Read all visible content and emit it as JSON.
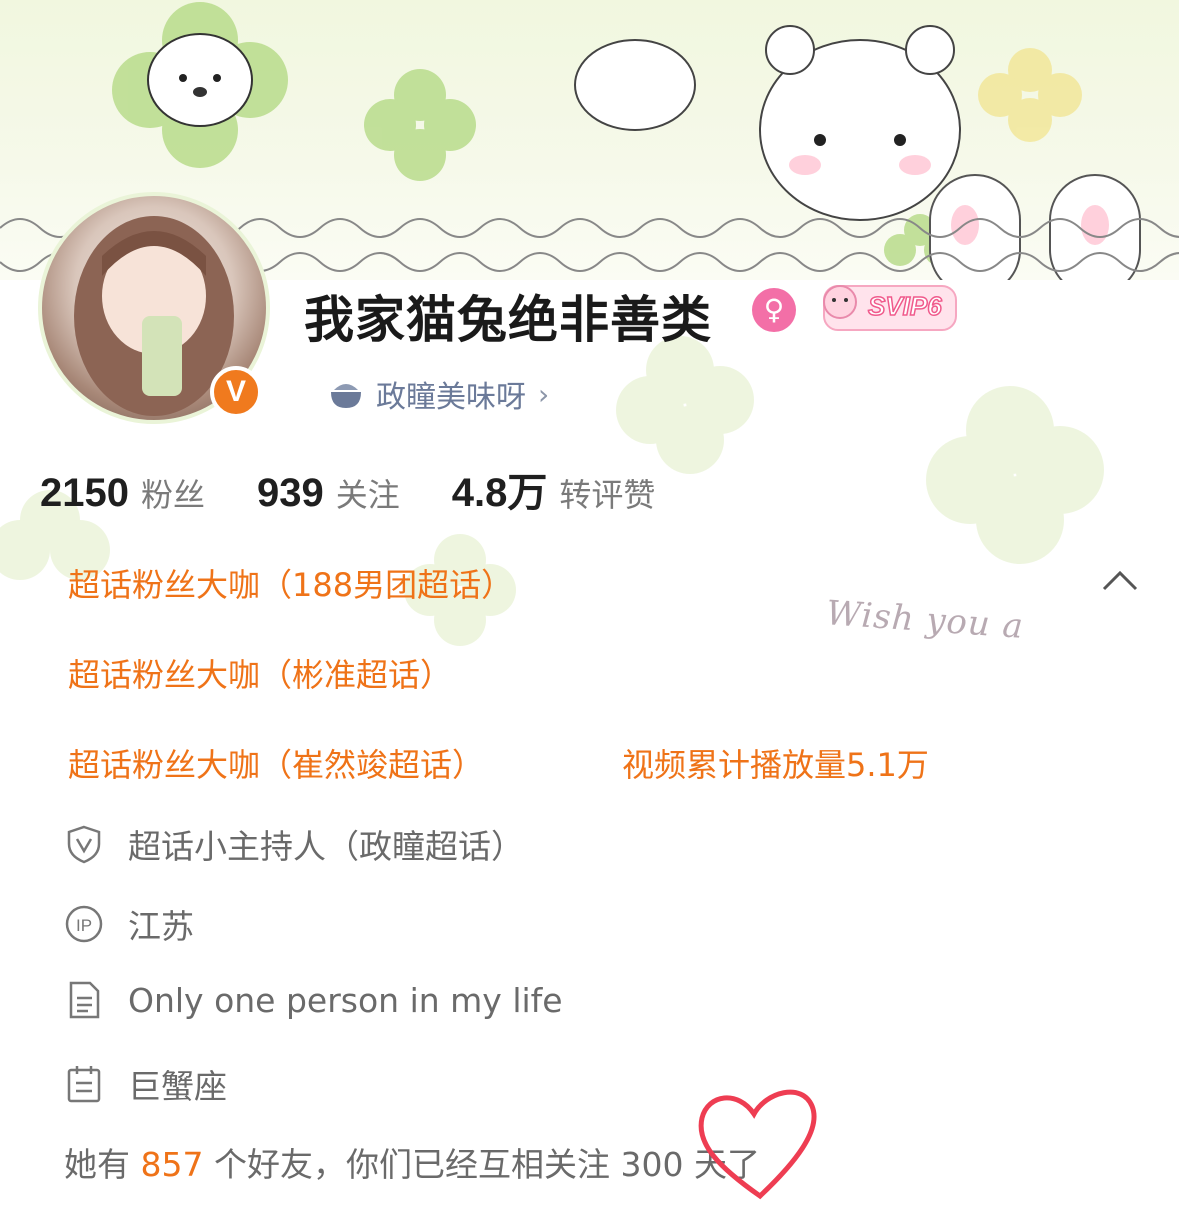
{
  "profile": {
    "name": "我家猫兔绝非善类",
    "gender_symbol": "♀",
    "svip_label": "SVIP6",
    "verify_mark": "V",
    "fanclub": {
      "label": "政瞳美味呀",
      "arrow": "›"
    }
  },
  "stats": [
    {
      "value": "2150",
      "label": "粉丝"
    },
    {
      "value": "939",
      "label": "关注"
    },
    {
      "value": "4.8万",
      "label": "转评赞"
    }
  ],
  "badges": [
    "超话粉丝大咖（188男团超话）",
    "超话粉丝大咖（彬准超话）",
    "超话粉丝大咖（崔然竣超话）",
    "视频累计播放量5.1万"
  ],
  "info": [
    {
      "icon": "shield-v-icon",
      "text": "超话小主持人（政瞳超话）"
    },
    {
      "icon": "ip-icon",
      "text": "江苏"
    },
    {
      "icon": "document-icon",
      "text": "Only one person in my life"
    },
    {
      "icon": "calendar-icon",
      "text": "巨蟹座"
    }
  ],
  "friends": {
    "prefix": "她有 ",
    "count": "857",
    "suffix": " 个好友，你们已经互相关注 300 天了"
  },
  "decor_text": "Wish you a",
  "colors": {
    "accent_orange": "#ef7318",
    "gender_pink": "#f36fa7",
    "link_blue": "#6b7a99"
  }
}
